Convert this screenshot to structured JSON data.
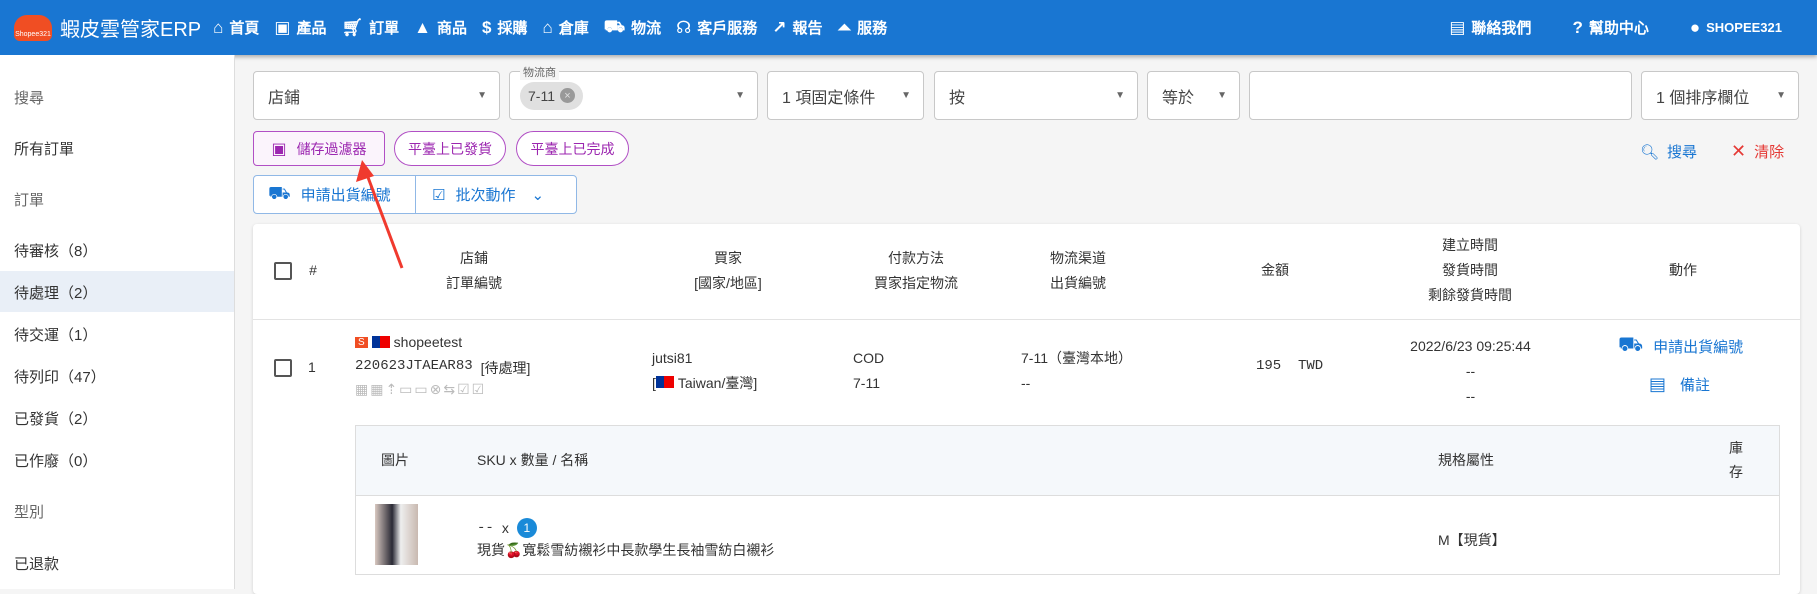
{
  "header": {
    "logo_text": "Shopee321",
    "brand": "蝦皮雲管家ERP",
    "nav": [
      {
        "icon": "home-icon",
        "label": "首頁"
      },
      {
        "icon": "bag-icon",
        "label": "產品"
      },
      {
        "icon": "cart-icon",
        "label": "訂單"
      },
      {
        "icon": "shapes-icon",
        "label": "商品"
      },
      {
        "icon": "dollar-icon",
        "label": "採購"
      },
      {
        "icon": "warehouse-icon",
        "label": "倉庫"
      },
      {
        "icon": "truck-icon",
        "label": "物流"
      },
      {
        "icon": "support-icon",
        "label": "客戶服務"
      },
      {
        "icon": "report-icon",
        "label": "報告"
      },
      {
        "icon": "service-icon",
        "label": "服務"
      }
    ],
    "contact": "聯絡我們",
    "help": "幫助中心",
    "user": "SHOPEE321"
  },
  "sidebar": {
    "items": [
      {
        "label": "搜尋",
        "type": "heading"
      },
      {
        "label": "所有訂單"
      },
      {
        "label": "訂單",
        "type": "heading"
      },
      {
        "label": "待審核（8）"
      },
      {
        "label": "待處理（2）",
        "active": true
      },
      {
        "label": "待交運（1）"
      },
      {
        "label": "待列印（47）"
      },
      {
        "label": "已發貨（2）"
      },
      {
        "label": "已作廢（0）"
      },
      {
        "label": "型別",
        "type": "heading"
      },
      {
        "label": "已退款"
      }
    ]
  },
  "filters": {
    "store": "店鋪",
    "carrier_label": "物流商",
    "carrier_chip": "7-11",
    "fixed": "1 項固定條件",
    "by": "按",
    "op": "等於",
    "value": "",
    "sort": "1 個排序欄位"
  },
  "chips": {
    "save": "儲存過濾器",
    "shipped": "平臺上已發貨",
    "completed": "平臺上已完成"
  },
  "actions": {
    "search": "搜尋",
    "clear": "清除",
    "apply": "申請出貨編號",
    "batch": "批次動作"
  },
  "table": {
    "headers": {
      "num": "#",
      "store": "店鋪",
      "order_no": "訂單編號",
      "buyer": "買家",
      "country": "[國家/地區]",
      "payment": "付款方法",
      "buyer_logistics": "買家指定物流",
      "channel": "物流渠道",
      "ship_no": "出貨編號",
      "amount": "金額",
      "created": "建立時間",
      "shipped": "發貨時間",
      "remaining": "剩餘發貨時間",
      "action": "動作"
    },
    "rows": [
      {
        "index": "1",
        "store": "shopeetest",
        "order_no": "220623JTAEAR83",
        "status": "[待處理]",
        "buyer": "jutsi81",
        "country": "Taiwan/臺灣",
        "payment": "COD",
        "buyer_logistics": "7-11",
        "channel": "7-11（臺灣本地）",
        "ship_no": "--",
        "amount": "195  TWD",
        "created": "2022/6/23 09:25:44",
        "shipped": "--",
        "remaining": "--",
        "apply": "申請出貨編號",
        "note": "備註",
        "items_header": {
          "image": "圖片",
          "sku": "SKU x 數量 / 名稱",
          "spec": "規格屬性",
          "stock": "庫存"
        },
        "items": [
          {
            "sku": "--",
            "x": "x",
            "qty": "1",
            "name": "現貨🍒寬鬆雪紡襯衫中長款學生長袖雪紡白襯衫",
            "spec": "M【現貨】"
          }
        ]
      }
    ]
  },
  "colors": {
    "primary": "#1976d2",
    "accent": "#9c27b0",
    "danger": "#e53935"
  }
}
